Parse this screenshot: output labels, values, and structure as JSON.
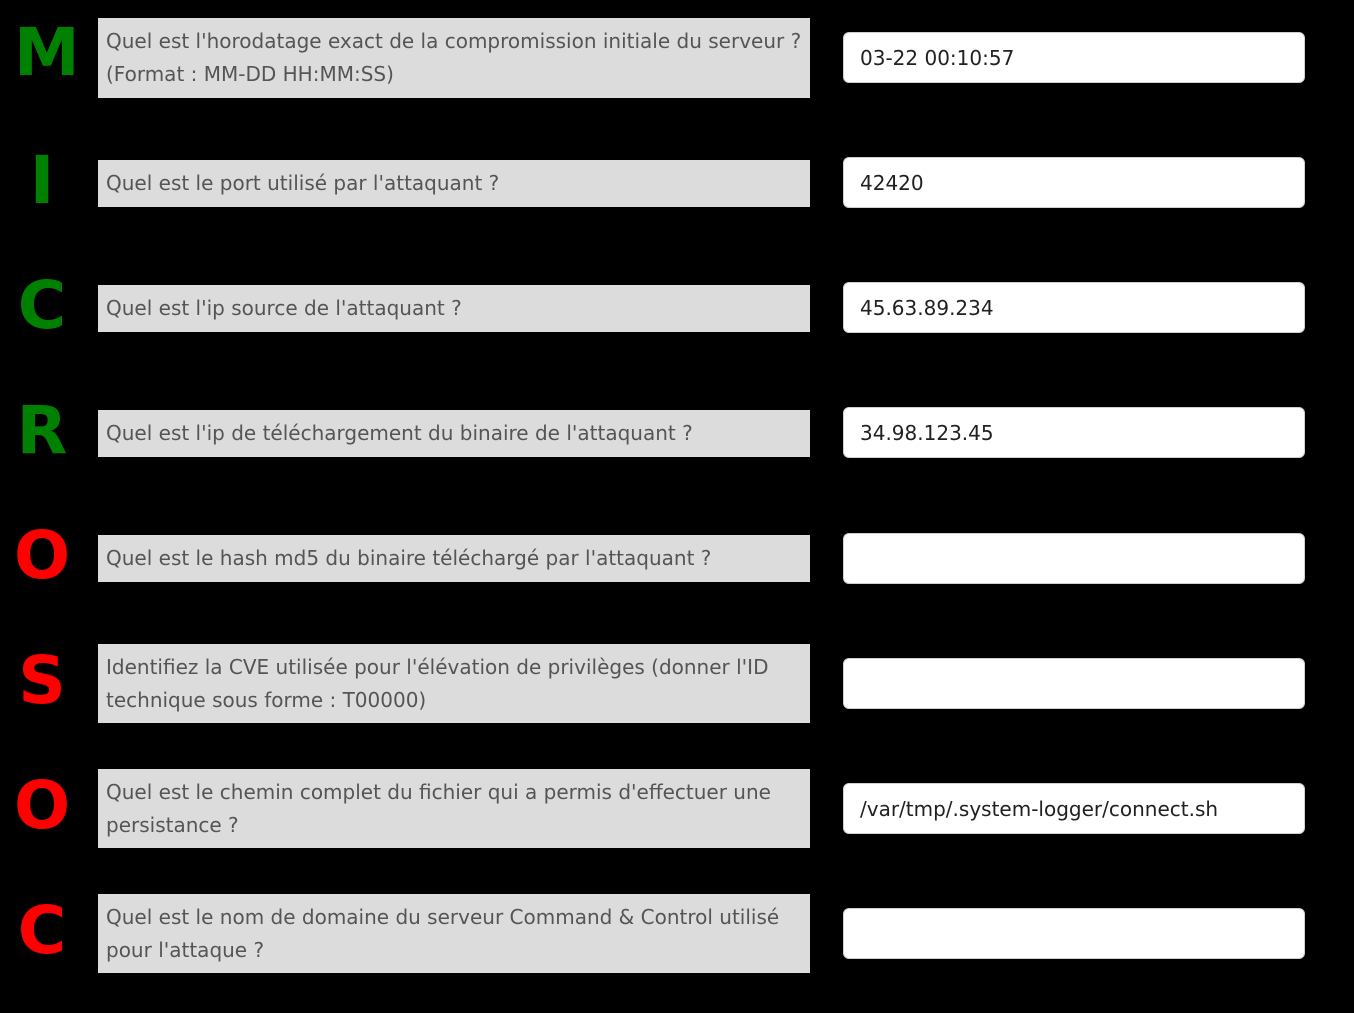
{
  "colors": {
    "background": "#000000",
    "letter_green": "#008000",
    "letter_red": "#ff0000",
    "question_bg": "#dcdcdc",
    "question_text": "#555555",
    "input_bg": "#ffffff"
  },
  "rows": [
    {
      "letter": "M",
      "letter_color": "green",
      "question": "Quel est l'horodatage exact de la compromission initiale du serveur ? (Format : MM-DD HH:MM:SS)",
      "answer": "03-22 00:10:57"
    },
    {
      "letter": "I",
      "letter_color": "green",
      "question": "Quel est le port utilisé par l'attaquant ?",
      "answer": "42420"
    },
    {
      "letter": "C",
      "letter_color": "green",
      "question": "Quel est l'ip source de l'attaquant ?",
      "answer": "45.63.89.234"
    },
    {
      "letter": "R",
      "letter_color": "green",
      "question": "Quel est l'ip de téléchargement du binaire de l'attaquant ?",
      "answer": "34.98.123.45"
    },
    {
      "letter": "O",
      "letter_color": "red",
      "question": "Quel est le hash md5 du binaire téléchargé par l'attaquant ?",
      "answer": ""
    },
    {
      "letter": "S",
      "letter_color": "red",
      "question": "Identifiez la CVE utilisée pour l'élévation de privilèges (donner l'ID technique sous forme : T00000)",
      "answer": ""
    },
    {
      "letter": "O",
      "letter_color": "red",
      "question": "Quel est le chemin complet du fichier qui a permis d'effectuer une persistance ?",
      "answer": "/var/tmp/.system-logger/connect.sh"
    },
    {
      "letter": "C",
      "letter_color": "red",
      "question": "Quel est le nom de domaine du serveur Command & Control utilisé pour l'attaque ?",
      "answer": ""
    }
  ]
}
